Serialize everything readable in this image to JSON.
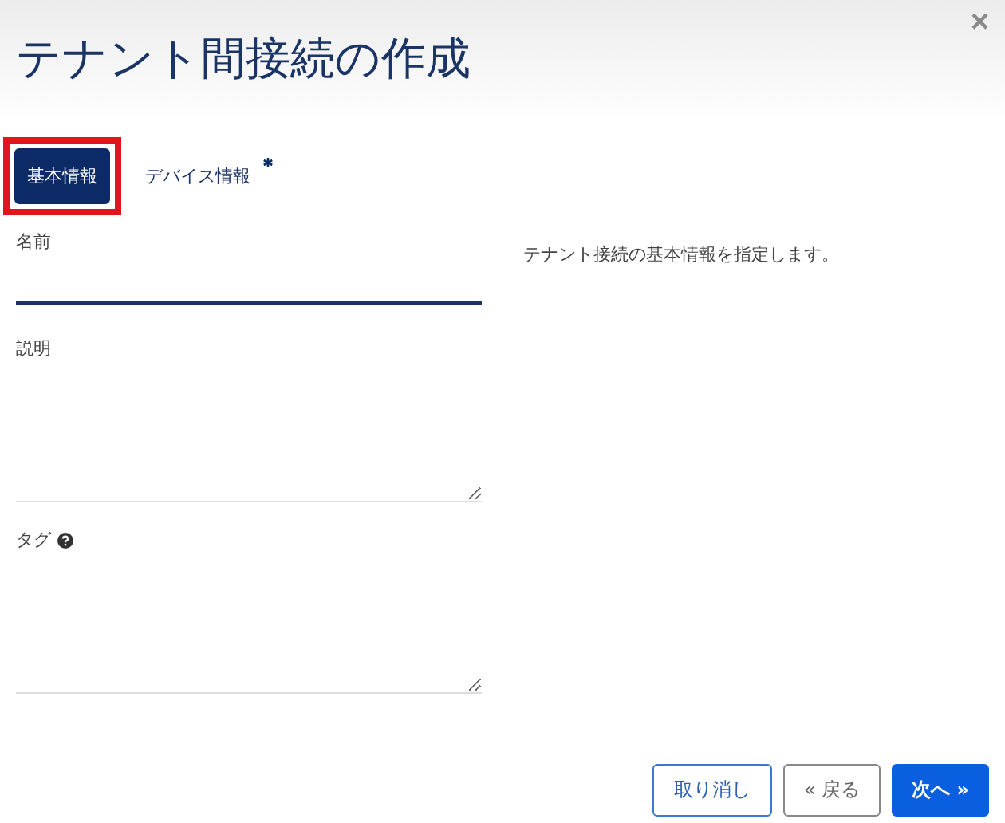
{
  "dialog": {
    "title": "テナント間接続の作成",
    "close": "×"
  },
  "tabs": [
    {
      "label": "基本情報",
      "selected": true,
      "required": false,
      "highlighted": true
    },
    {
      "label": "デバイス情報",
      "selected": false,
      "required": true,
      "highlighted": false
    }
  ],
  "fields": [
    {
      "label": "名前",
      "kind": "input",
      "help": false
    },
    {
      "label": "説明",
      "kind": "textarea",
      "help": false
    },
    {
      "label": "タグ",
      "kind": "textarea",
      "help": true
    }
  ],
  "description": "テナント接続の基本情報を指定します。",
  "buttons": [
    {
      "label": "取り消し",
      "kind": "cancel"
    },
    {
      "label": "« 戻る",
      "kind": "back"
    },
    {
      "label": "次へ »",
      "kind": "primary"
    }
  ]
}
